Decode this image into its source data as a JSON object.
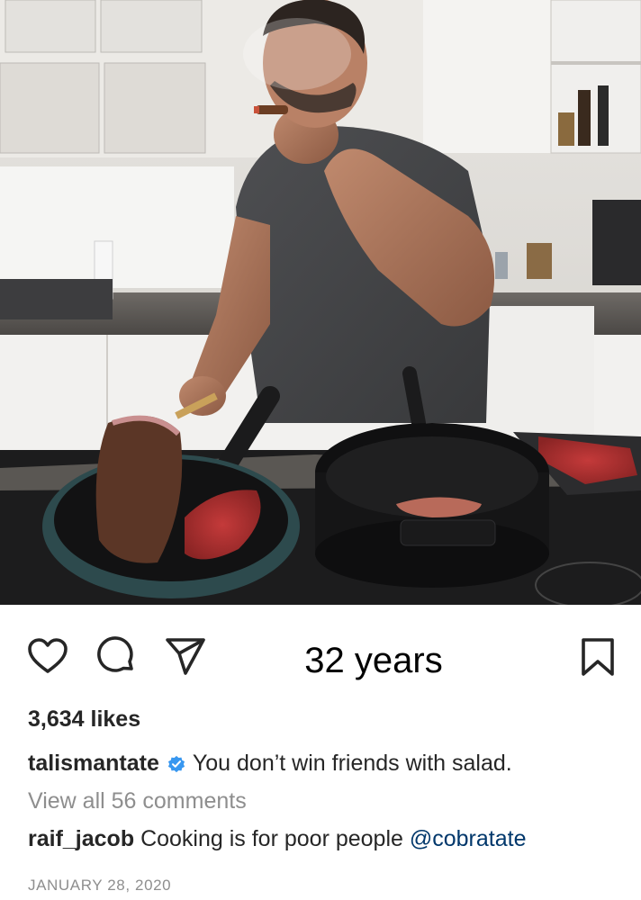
{
  "post": {
    "image_alt": "photo",
    "overlay_text": "32 years",
    "likes": "3,634 likes",
    "caption": {
      "username": "talismantate",
      "verified": true,
      "text": "You don’t win friends with salad."
    },
    "view_comments": "View all 56 comments",
    "comment": {
      "username": "raif_jacob",
      "text": "Cooking is for poor people",
      "mention": "@cobratate"
    },
    "date": "JANUARY 28, 2020"
  },
  "icons": {
    "like": "heart-icon",
    "comment": "speech-bubble-icon",
    "share": "paper-plane-icon",
    "save": "bookmark-icon",
    "verified": "verified-badge-icon"
  },
  "colors": {
    "text": "#262626",
    "muted": "#8e8e8e",
    "mention": "#00376b",
    "verified": "#3897f0"
  }
}
